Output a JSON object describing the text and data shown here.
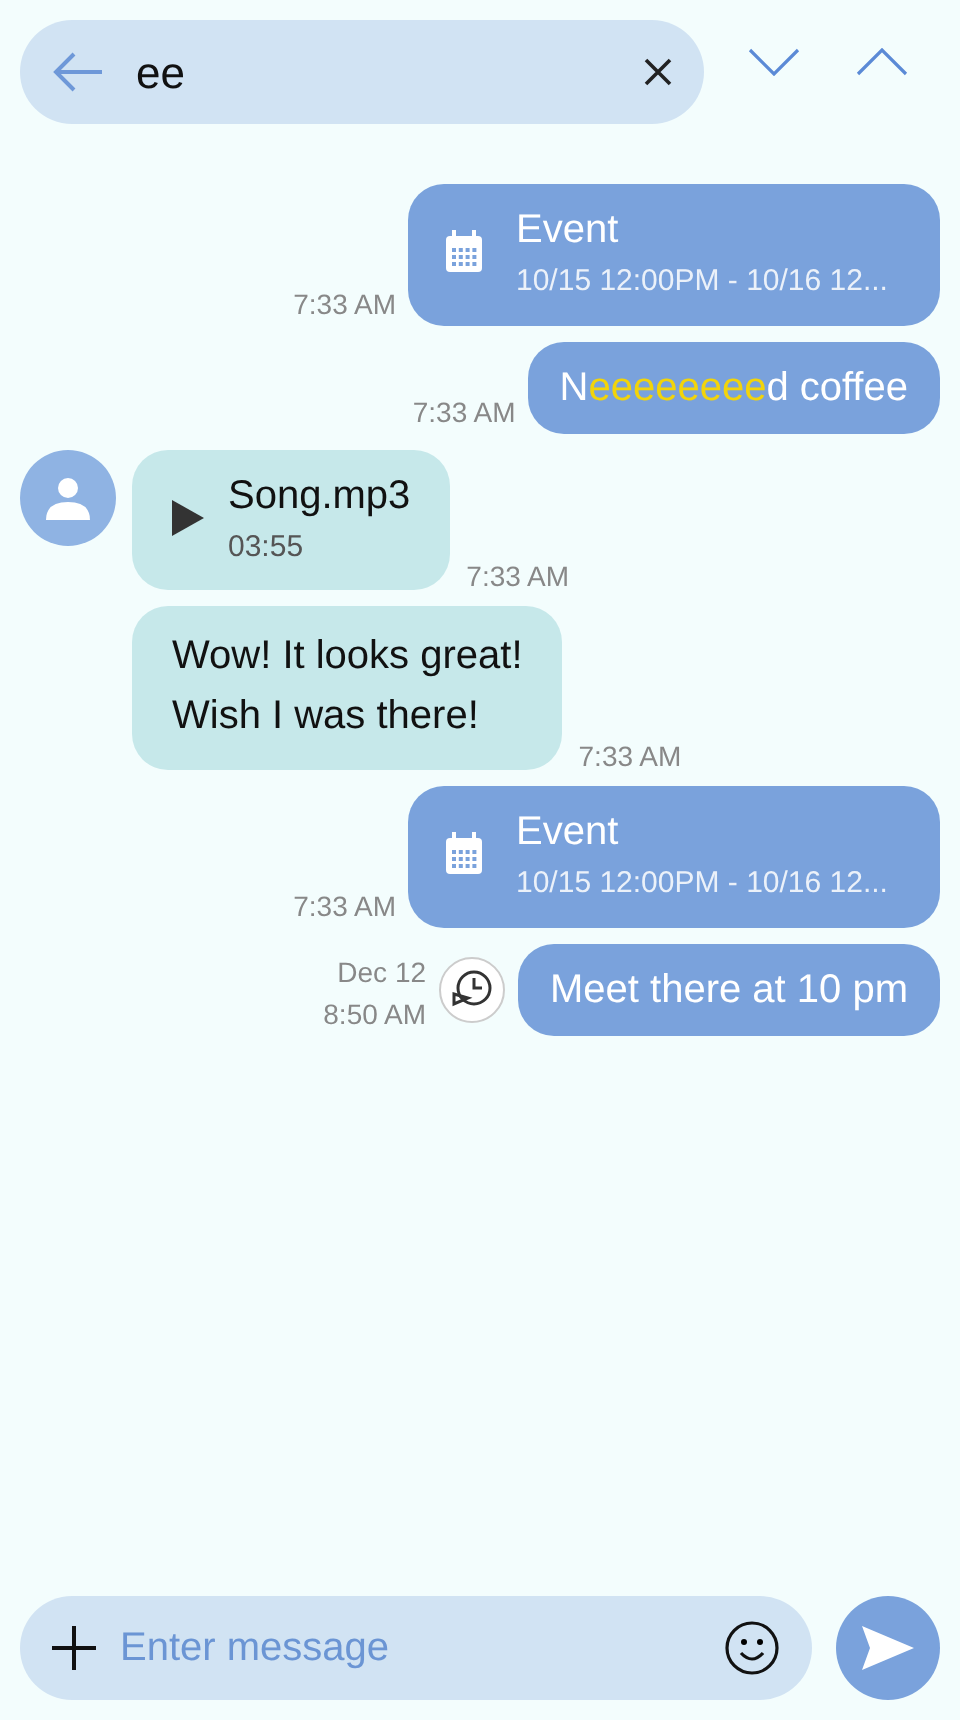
{
  "search": {
    "value": "ee"
  },
  "messages": [
    {
      "kind": "event",
      "sent": true,
      "title": "Event",
      "detail": "10/15 12:00PM - 10/16 12...",
      "time": "7:33 AM"
    },
    {
      "kind": "text",
      "sent": true,
      "segments": [
        {
          "text": "N",
          "highlight": false
        },
        {
          "text": "eeeeeeee",
          "highlight": true
        },
        {
          "text": "d coffee",
          "highlight": false
        }
      ],
      "time": "7:33 AM"
    },
    {
      "kind": "audio",
      "sent": false,
      "avatar": true,
      "title": "Song.mp3",
      "detail": "03:55",
      "time": "7:33 AM"
    },
    {
      "kind": "text",
      "sent": false,
      "avatar": false,
      "segments": [
        {
          "text": "Wow! It looks great!\nWish I was there!",
          "highlight": false
        }
      ],
      "time": "7:33 AM"
    },
    {
      "kind": "event",
      "sent": true,
      "title": "Event",
      "detail": "10/15 12:00PM - 10/16 12...",
      "time": "7:33 AM"
    },
    {
      "kind": "scheduled",
      "sent": true,
      "segments": [
        {
          "text": "Meet there at 10 pm",
          "highlight": false
        }
      ],
      "date": "Dec 12",
      "time": "8:50 AM"
    }
  ],
  "composer": {
    "placeholder": "Enter message"
  }
}
